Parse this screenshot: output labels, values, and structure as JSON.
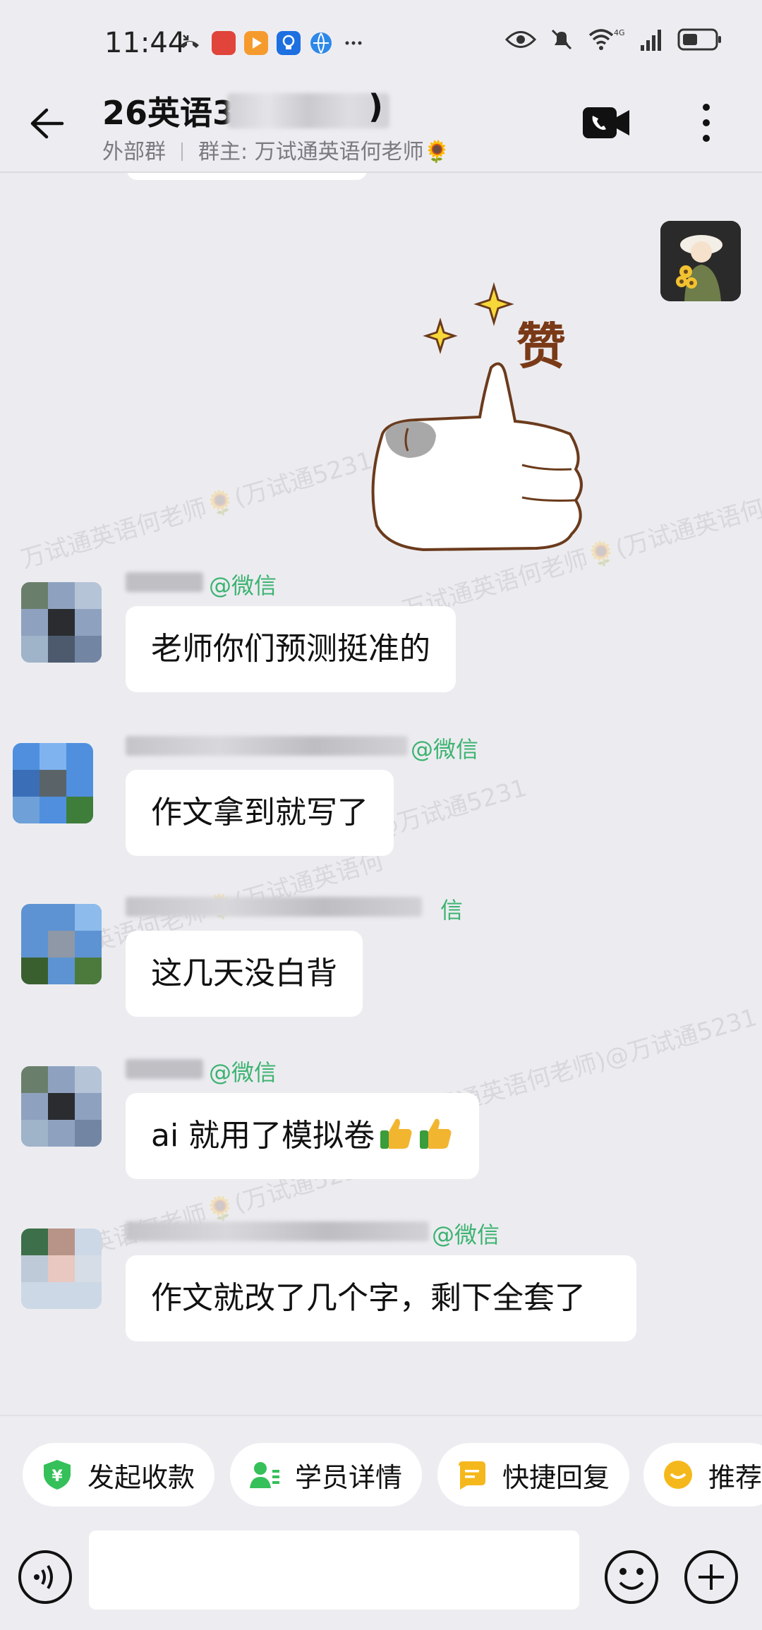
{
  "status_bar": {
    "time": "11:44",
    "network": "4G"
  },
  "header": {
    "title": "26英语3",
    "title_suffix": ")",
    "group_type": "外部群",
    "owner": "群主: 万试通英语何老师🌻"
  },
  "watermarks": [
    "万试通英语何老师🌻(万试通5231",
    "师)@万试通5231",
    "万试通英语何老师🌻(万试通英语何",
    "(万试通英语何老师)@万试通5231"
  ],
  "sticker": {
    "text": "赞"
  },
  "messages": [
    {
      "sender_tag": "@微信",
      "text": "老师你们预测挺准的"
    },
    {
      "sender_tag": "@微信",
      "text": "作文拿到就写了"
    },
    {
      "sender_tag": "信",
      "text": "这几天没白背"
    },
    {
      "sender_tag": "@微信",
      "text": "ai 就用了模拟卷"
    },
    {
      "sender_tag": "@微信",
      "text": "作文就改了几个字，剩下全套了"
    }
  ],
  "quick_actions": [
    {
      "label": "发起收款",
      "icon": "payment-shield-icon",
      "color": "#35c05a"
    },
    {
      "label": "学员详情",
      "icon": "student-icon",
      "color": "#35c05a"
    },
    {
      "label": "快捷回复",
      "icon": "quick-reply-icon",
      "color": "#f5b81c"
    },
    {
      "label": "推荐",
      "icon": "recommend-icon",
      "color": "#f5b81c"
    }
  ],
  "input": {
    "placeholder": ""
  },
  "colors": {
    "background": "#ececf0",
    "bubble": "#ffffff",
    "accent_green": "#3cb371"
  }
}
